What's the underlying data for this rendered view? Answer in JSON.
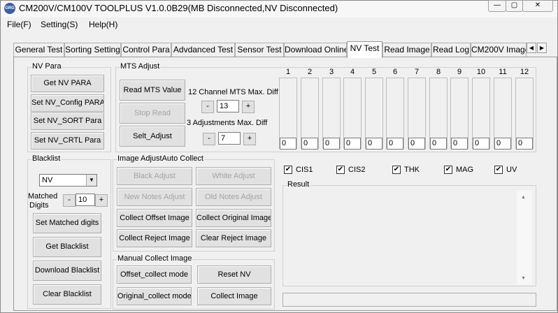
{
  "window": {
    "icon_text": "GRG",
    "title": "CM200V/CM100V TOOLPLUS V1.0.0B29(MB Disconnected,NV Disconnected)",
    "minimize_glyph": "—",
    "restore_glyph": "▢",
    "close_glyph": "✕"
  },
  "menu": [
    "File(F)",
    "Setting(S)",
    "Help(H)"
  ],
  "tabs": [
    "General Test",
    "Sorting Setting",
    "Control Para",
    "Advdanced Test",
    "Sensor Test",
    "Download Online",
    "NV Test",
    "Read Image",
    "Read Log",
    "CM200V Image"
  ],
  "active_tab": "NV Test",
  "tab_scroll": {
    "left": "◀",
    "right": "▶"
  },
  "nv_para": {
    "title": "NV Para",
    "buttons": [
      "Get NV PARA",
      "Set NV_Config PARA",
      "Set NV_SORT Para",
      "Set NV_CRTL Para"
    ]
  },
  "mts_adjust": {
    "title": "MTS Adjust",
    "read_button": "Read MTS Value",
    "stop_button": "Stop Read",
    "selt_button": "Selt_Adjust",
    "diff12_label": "12 Channel MTS Max. Diff",
    "diff12_value": "13",
    "adj3_label": "3 Adjustments Max. Diff",
    "adj3_value": "7",
    "minus": "-",
    "plus": "+"
  },
  "channels": {
    "numbers": [
      "1",
      "2",
      "3",
      "4",
      "5",
      "6",
      "7",
      "8",
      "9",
      "10",
      "11",
      "12"
    ],
    "values": [
      "0",
      "0",
      "0",
      "0",
      "0",
      "0",
      "0",
      "0",
      "0",
      "0",
      "0",
      "0"
    ]
  },
  "blacklist": {
    "title": "Blacklist",
    "select_value": "NV",
    "matched_label_1": "Matched",
    "matched_label_2": "Digits",
    "matched_value": "10",
    "minus": "-",
    "plus": "+",
    "buttons": [
      "Set Matched digits",
      "Get Blacklist",
      "Download Blacklist",
      "Clear Blacklist"
    ]
  },
  "image_adjust": {
    "title": "Image AdjustAuto Collect",
    "black_adjust": "Black Adjust",
    "white_adjust": "White Adjust",
    "new_notes_adjust": "New Notes Adjust",
    "old_notes_adjust": "Old Notes Adjust",
    "collect_offset": "Collect Offset Image",
    "collect_original": "Collect Original Image",
    "collect_reject": "Collect Reject Image",
    "clear_reject": "Clear Reject Image"
  },
  "manual_collect": {
    "title": "Manual Collect Image",
    "offset_mode": "Offset_collect mode",
    "reset_nv": "Reset NV",
    "original_mode": "Original_collect mode",
    "collect_image": "Collect Image"
  },
  "sensors": [
    {
      "label": "CIS1",
      "checked": true
    },
    {
      "label": "CIS2",
      "checked": true
    },
    {
      "label": "THK",
      "checked": true
    },
    {
      "label": "MAG",
      "checked": true
    },
    {
      "label": "UV",
      "checked": true
    }
  ],
  "check_glyph": "✔",
  "result": {
    "title": "Result",
    "scroll_up": "▲",
    "scroll_down": "▼"
  }
}
